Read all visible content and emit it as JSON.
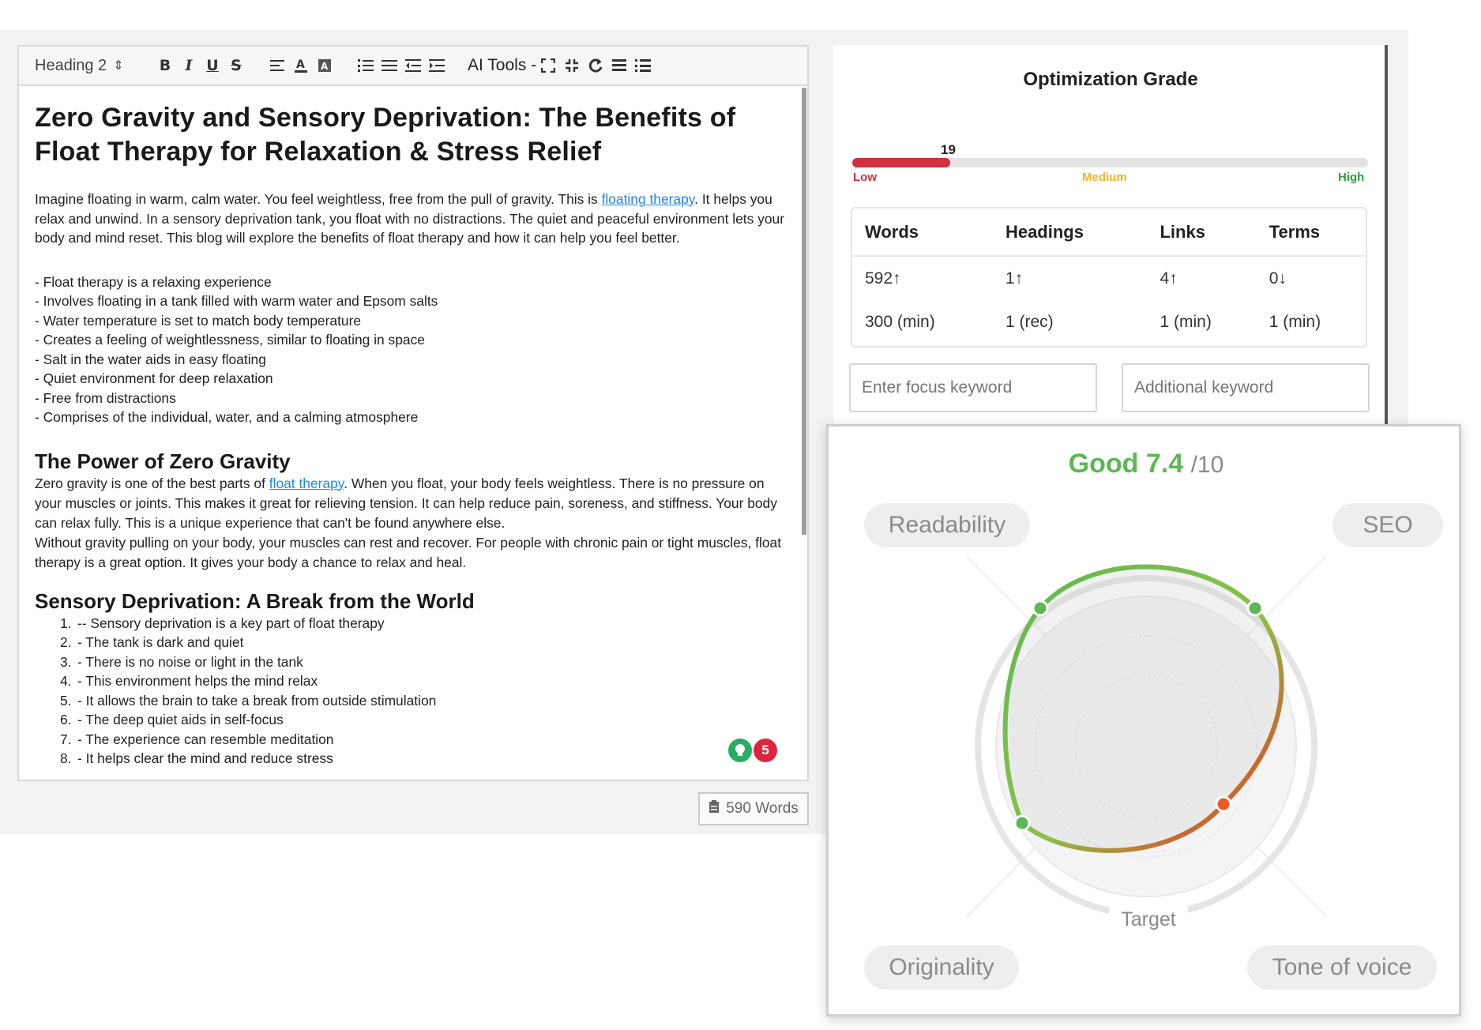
{
  "editor": {
    "toolbar": {
      "heading_select": "Heading 2",
      "heading_arrow": "⇕",
      "ai_tools": "AI Tools -"
    },
    "title": "Zero Gravity and Sensory Deprivation: The Benefits of Float Therapy for Relaxation & Stress Relief",
    "intro": {
      "before_link": "Imagine floating in warm, calm water. You feel weightless, free from the pull of gravity. This is ",
      "link": "floating therapy",
      "after_link": ". It helps you relax and unwind. In a sensory deprivation tank, you float with no distractions. The quiet and peaceful environment lets your body and mind reset. This blog will explore the benefits of float therapy and how it can help you feel better."
    },
    "bullets": [
      "- Float therapy is a relaxing experience",
      "- Involves floating in a tank filled with warm water and Epsom salts",
      "- Water temperature is set to match body temperature",
      "- Creates a feeling of weightlessness, similar to floating in space",
      "- Salt in the water aids in easy floating",
      "- Quiet environment for deep relaxation",
      "- Free from distractions",
      "- Comprises of the individual, water, and a calming atmosphere"
    ],
    "section1": {
      "heading": "The Power of Zero Gravity",
      "before_link": "Zero gravity is one of the best parts of ",
      "link": "float therapy",
      "after_link": ". When you float, your body feels weightless. There is no pressure on your muscles or joints. This makes it great for relieving tension. It can help reduce pain, soreness, and stiffness. Your body can relax fully. This is a unique experience that can't be found anywhere else.",
      "para2": "Without gravity pulling on your body, your muscles can rest and recover. For people with chronic pain or tight muscles, float therapy is a great option. It gives your body a chance to relax and heal."
    },
    "section2": {
      "heading": "Sensory Deprivation: A Break from the World",
      "items": [
        {
          "num": "1.",
          "text": "-- Sensory deprivation is a key part of float therapy"
        },
        {
          "num": "2.",
          "text": "- The tank is dark and quiet"
        },
        {
          "num": "3.",
          "text": "- There is no noise or light in the tank"
        },
        {
          "num": "4.",
          "text": "- This environment helps the mind relax"
        },
        {
          "num": "5.",
          "text": "- It allows the brain to take a break from outside stimulation"
        },
        {
          "num": "6.",
          "text": "- The deep quiet aids in self-focus"
        },
        {
          "num": "7.",
          "text": "- The experience can resemble meditation"
        },
        {
          "num": "8.",
          "text": "- It helps clear the mind and reduce stress"
        }
      ]
    },
    "badges": {
      "suggestions": "5"
    },
    "word_count": "590 Words"
  },
  "optimization": {
    "title": "Optimization Grade",
    "grade_value": "19",
    "grade_fraction": 0.19,
    "levels": {
      "low": "Low",
      "medium": "Medium",
      "high": "High"
    },
    "colors": {
      "low": "#d0313f",
      "medium": "#f0b429",
      "high": "#2e9e3f"
    },
    "stats": {
      "headers": [
        "Words",
        "Headings",
        "Links",
        "Terms"
      ],
      "current": [
        "592↑",
        "1↑",
        "4↑",
        "0↓"
      ],
      "current_trend": [
        "up",
        "up",
        "up",
        "down"
      ],
      "targets": [
        "300 (min)",
        "1 (rec)",
        "1 (min)",
        "1 (min)"
      ]
    },
    "focus_keyword_placeholder": "Enter focus keyword",
    "additional_keyword_placeholder": "Additional keyword"
  },
  "score_card": {
    "rating": "Good 7.4",
    "denominator": "/10",
    "labels": {
      "readability": "Readability",
      "seo": "SEO",
      "originality": "Originality",
      "tone": "Tone of voice",
      "target": "Target"
    }
  }
}
